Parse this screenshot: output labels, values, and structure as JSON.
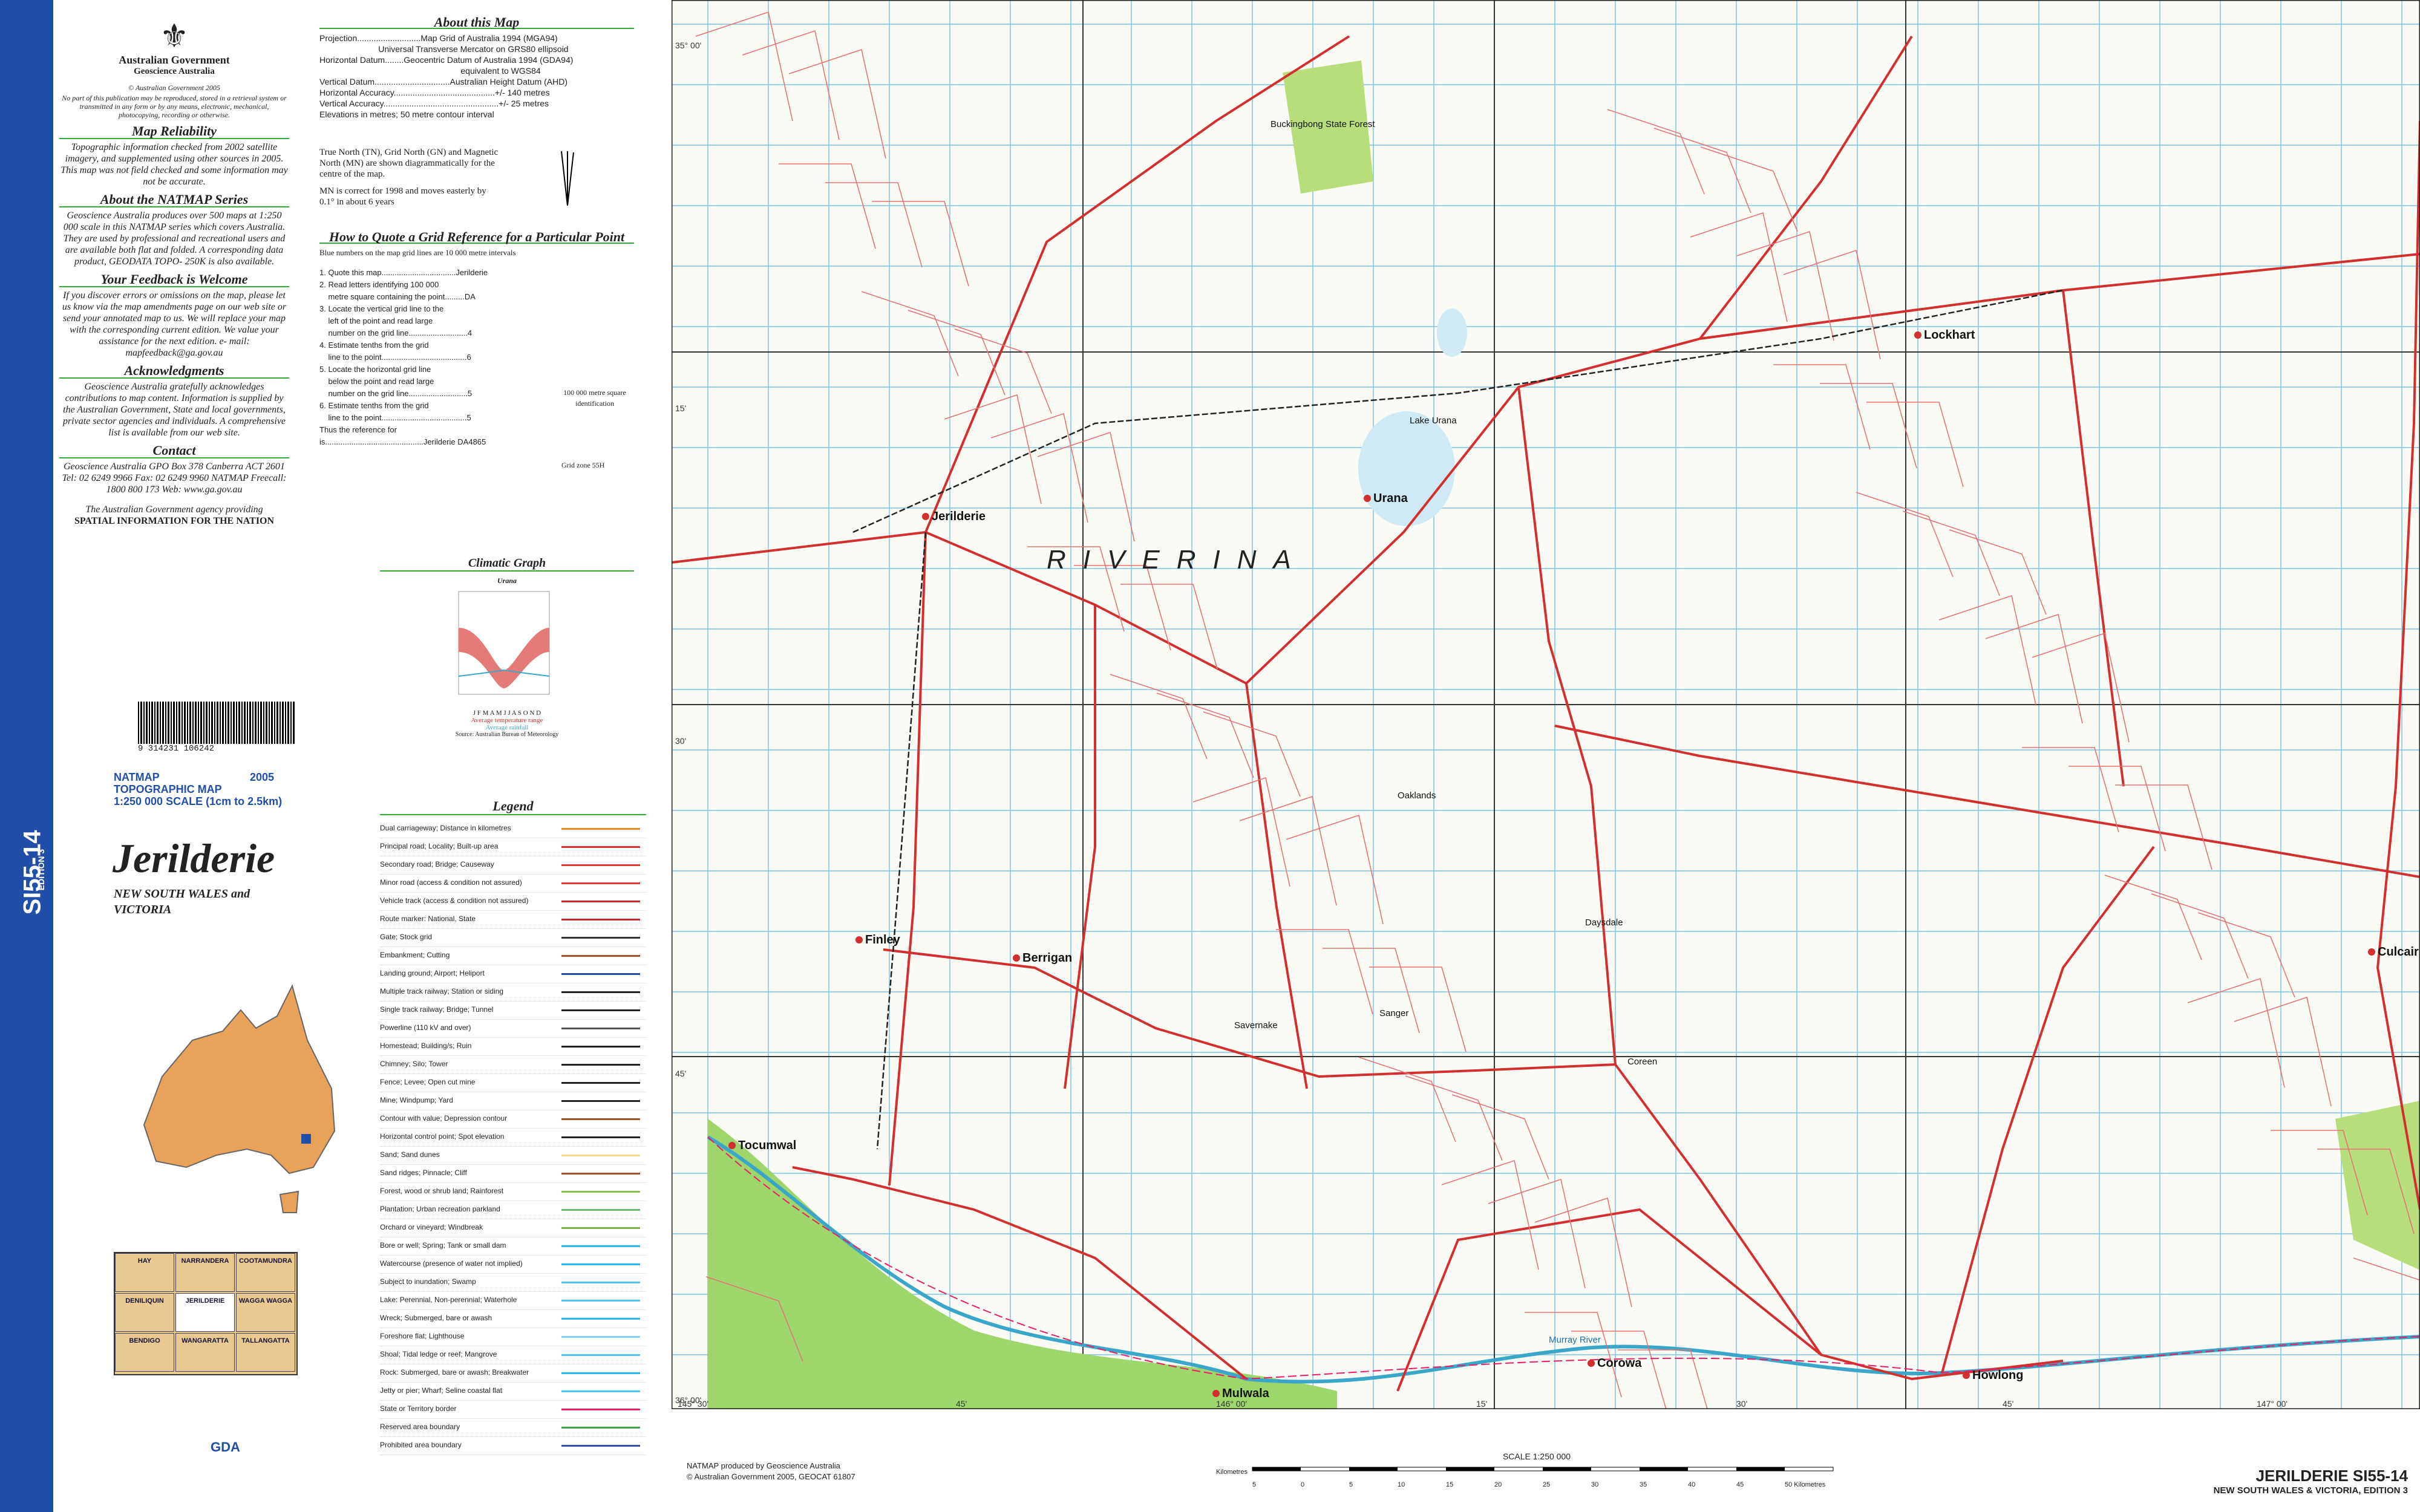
{
  "spine": {
    "code": "SI55-14",
    "edition": "EDITION 3"
  },
  "govt": {
    "line1": "Australian Government",
    "line2": "Geoscience Australia",
    "copyright": "© Australian Government 2005",
    "copy_note": "No part of this publication may be reproduced, stored in a retrieval system or transmitted in any form or by any means, electronic, mechanical, photocopying, recording or otherwise."
  },
  "reliability": {
    "heading": "Map Reliability",
    "text": "Topographic information checked from 2002 satellite imagery, and supplemented using other sources in 2005. This map was not field checked and some information may not be accurate."
  },
  "natmap_series": {
    "heading": "About the NATMAP Series",
    "text": "Geoscience Australia produces over 500 maps at 1:250 000 scale in this NATMAP series which covers Australia. They are used by professional and recreational users and are available both flat and folded. A corresponding data product, GEODATA TOPO- 250K is also available."
  },
  "feedback": {
    "heading": "Your Feedback is Welcome",
    "text": "If you discover errors or omissions on the map, please let us know via the map amendments page on our web site or send your annotated map to us. We will replace your map with the corresponding current edition. We value your assistance for the next edition. e- mail: mapfeedback@ga.gov.au"
  },
  "ack": {
    "heading": "Acknowledgments",
    "text": "Geoscience Australia gratefully acknowledges contributions to map content. Information is supplied by the Australian Government, State and local governments, private sector agencies and individuals. A comprehensive list is available from our web site."
  },
  "contact": {
    "heading": "Contact",
    "text": "Geoscience Australia GPO Box 378 Canberra ACT 2601 Tel: 02 6249 9966 Fax: 02 6249 9960 NATMAP Freecall: 1800 800 173 Web: www.ga.gov.au",
    "agency": "The Australian Government agency providing",
    "tagline": "SPATIAL INFORMATION FOR THE NATION"
  },
  "barcode": "9 314231 106242",
  "natmap": {
    "label": "NATMAP",
    "year": "2005",
    "type": "TOPOGRAPHIC MAP",
    "scale": "1:250 000 SCALE (1cm to 2.5km)"
  },
  "title": "Jerilderie",
  "subtitle": "NEW SOUTH WALES and VICTORIA",
  "about": {
    "heading": "About this Map",
    "lines": "Projection...........................Map Grid of Australia 1994 (MGA94)\n                         Universal Transverse Mercator on GRS80 ellipsoid\nHorizontal Datum........Geocentric Datum of Australia 1994 (GDA94)\n                                                            equivalent to WGS84\nVertical Datum................................Australian Height Datum (AHD)\nHorizontal Accuracy...........................................+/- 140 metres\nVertical Accuracy.................................................+/- 25 metres\nElevations in metres; 50 metre contour interval",
    "north": "True North (TN), Grid North (GN) and Magnetic North (MN) are shown diagrammatically for the centre of the map.",
    "mn": "MN is correct for 1998 and moves easterly by 0.1° in about 6 years"
  },
  "gridref": {
    "heading": "How to Quote a Grid Reference for a Particular Point",
    "intro": "Blue numbers on the map grid lines are 10 000 metre intervals",
    "steps": "1. Quote this map..................................Jerilderie\n2. Read letters identifying 100 000\n    metre square containing the point.........DA\n3. Locate the vertical grid line to the\n    left of the point and read large\n    number on the grid line...........................4\n4. Estimate tenths from the grid\n    line to the point.......................................6\n5. Locate the horizontal grid line\n    below the point and read large\n    number on the grid line...........................5\n6. Estimate tenths from the grid\n    line to the point.......................................5\nThus the reference for\nis.............................................Jerilderie DA4865",
    "square": "100 000 metre square identification",
    "zone": "Grid zone 55H"
  },
  "climate": {
    "heading": "Climatic Graph",
    "station": "Urana",
    "months": "J F M A M J J A S O N D",
    "temp": "Average temperature range",
    "rain": "Average rainfall",
    "source": "Source: Australian Bureau of Meteorology"
  },
  "legend": {
    "heading": "Legend",
    "items": [
      "Dual carriageway; Distance in kilometres",
      "Principal road; Locality; Built-up area",
      "Secondary road; Bridge; Causeway",
      "Minor road (access & condition not assured)",
      "Vehicle track (access & condition not assured)",
      "Route marker: National, State",
      "Gate; Stock grid",
      "Embankment; Cutting",
      "Landing ground; Airport; Heliport",
      "Multiple track railway; Station or siding",
      "Single track railway; Bridge; Tunnel",
      "Powerline (110 kV and over)",
      "Homestead; Building/s; Ruin",
      "Chimney; Silo; Tower",
      "Fence; Levee; Open cut mine",
      "Mine; Windpump; Yard",
      "Contour with value; Depression contour",
      "Horizontal control point; Spot elevation",
      "Sand; Sand dunes",
      "Sand ridges; Pinnacle; Cliff",
      "Forest, wood or shrub land; Rainforest",
      "Plantation; Urban recreation parkland",
      "Orchard or vineyard; Windbreak",
      "Bore or well; Spring; Tank or small dam",
      "Watercourse (presence of water not implied)",
      "Subject to inundation; Swamp",
      "Lake: Perennial, Non-perennial; Waterhole",
      "Wreck; Submerged, bare or awash",
      "Foreshore flat; Lighthouse",
      "Shoal; Tidal ledge or reef; Mangrove",
      "Rock: Submerged, bare or awash; Breakwater",
      "Jetty or pier; Wharf; Seline coastal flat",
      "State or Territory border",
      "Reserved area boundary",
      "Prohibited area boundary"
    ]
  },
  "index_sheets": [
    [
      "HAY",
      "NARRANDERA",
      "COOTAMUNDRA"
    ],
    [
      "DENILIQUIN",
      "JERILDERIE",
      "WAGGA WAGGA"
    ],
    [
      "BENDIGO",
      "WANGARATTA",
      "TALLANGATTA"
    ]
  ],
  "map": {
    "region": "RIVERINA",
    "towns": [
      "Jerilderie",
      "Urana",
      "Berrigan",
      "Finley",
      "Tocumwal",
      "Mulwala",
      "Corowa",
      "Howlong",
      "Lockhart",
      "Culcairn",
      "Oaklands",
      "Coreen",
      "Daysdale",
      "Savernake",
      "Sanger",
      "Lake Urana",
      "Buckingbong State Forest",
      "Murray River"
    ],
    "lat": [
      "35° 00'",
      "15'",
      "30'",
      "45'",
      "36° 00'"
    ],
    "lon": [
      "145° 30'",
      "45'",
      "146° 00'",
      "15'",
      "30'",
      "45'",
      "147° 00'"
    ]
  },
  "producer": {
    "line1": "NATMAP produced by Geoscience Australia",
    "line2": "© Australian Government 2005, GEOCAT 61807"
  },
  "scalebar": {
    "label": "SCALE 1:250 000",
    "unit": "Kilometres",
    "ticks": [
      "5",
      "0",
      "5",
      "10",
      "15",
      "20",
      "25",
      "30",
      "35",
      "40",
      "45",
      "50 Kilometres"
    ]
  },
  "sheet": {
    "name": "JERILDERIE SI55-14",
    "edition": "NEW SOUTH WALES & VICTORIA, EDITION 3"
  },
  "gda": "GDA"
}
